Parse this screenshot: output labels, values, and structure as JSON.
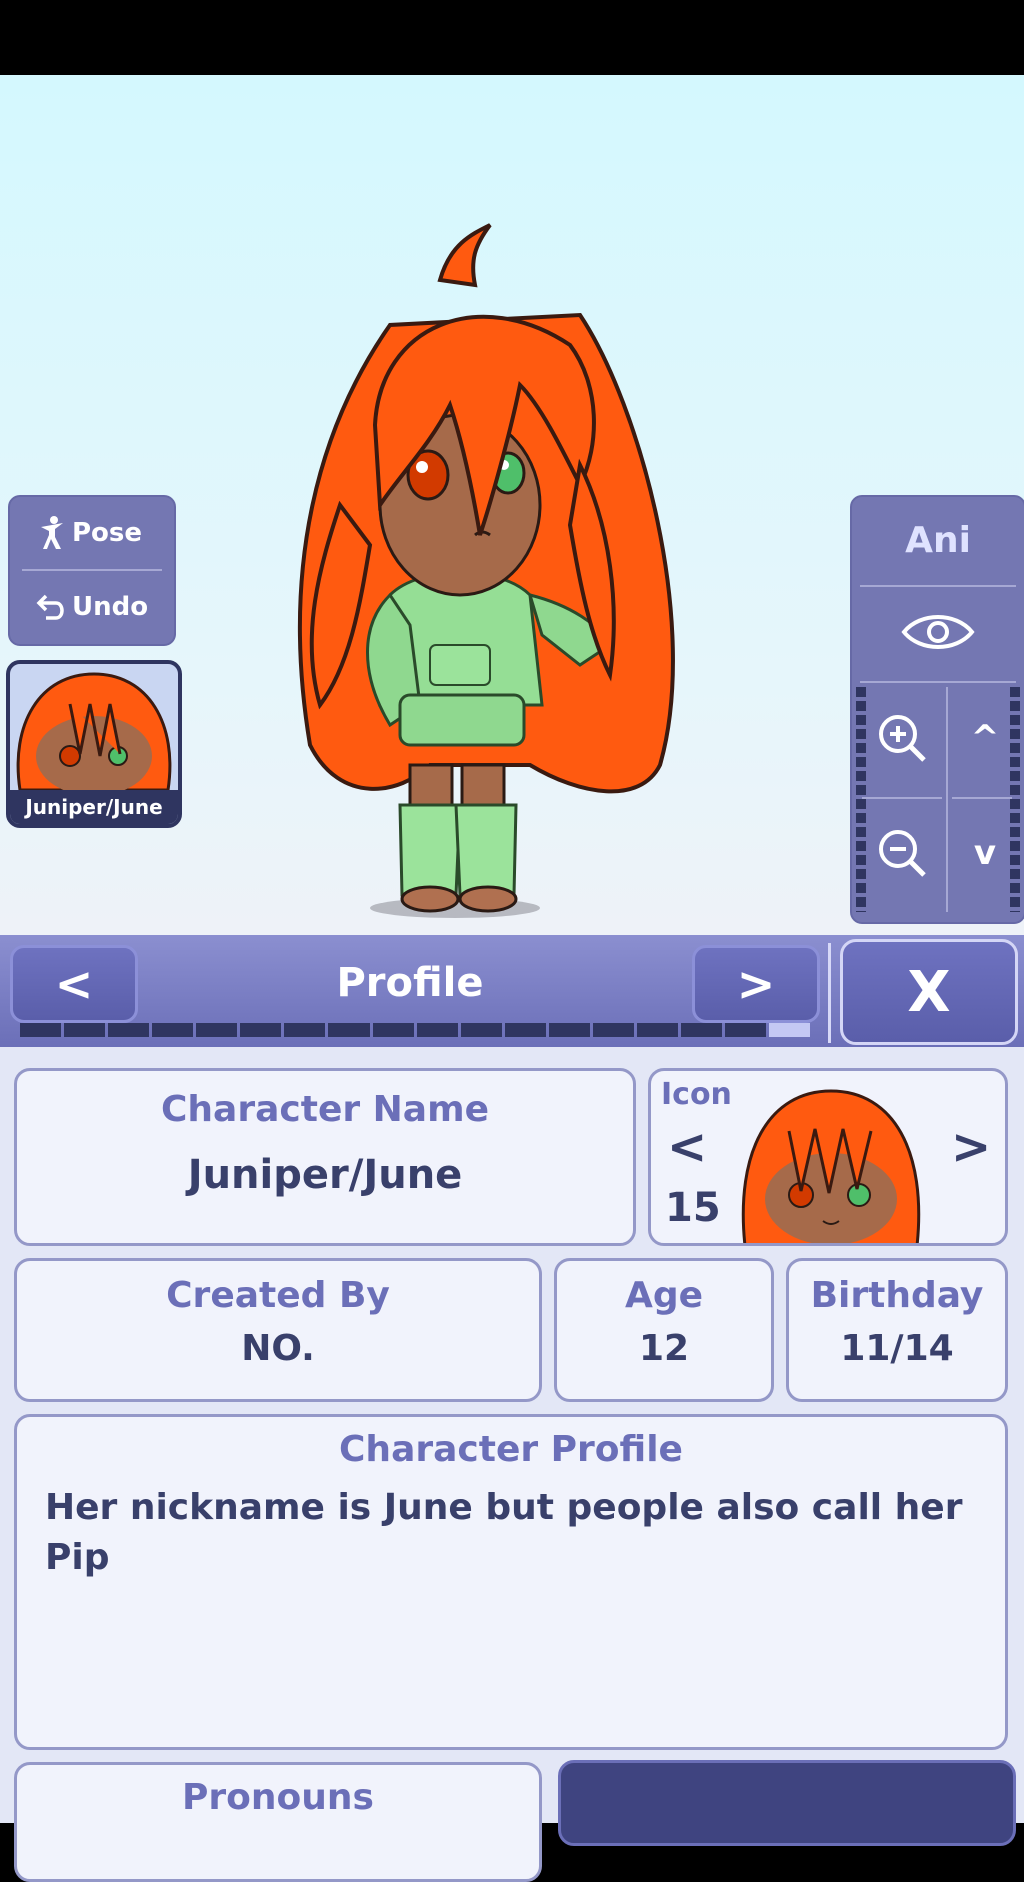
{
  "left_panel": {
    "pose_label": "Pose",
    "undo_label": "Undo"
  },
  "character_thumb": {
    "label": "Juniper/June"
  },
  "right_panel": {
    "ani_label": "Ani"
  },
  "header": {
    "title": "Profile",
    "prev": "<",
    "next": ">",
    "close": "X",
    "progress_segments": 18,
    "progress_active_index": 17
  },
  "profile": {
    "name_title": "Character Name",
    "name_value": "Juniper/June",
    "icon_label": "Icon",
    "icon_number": "15",
    "created_by_title": "Created By",
    "created_by_value": "NO.",
    "age_title": "Age",
    "age_value": "12",
    "birthday_title": "Birthday",
    "birthday_value": "11/14",
    "profile_title": "Character Profile",
    "profile_text": "Her nickname is June but people also call her Pip",
    "pronouns_title": "Pronouns"
  },
  "colors": {
    "panel": "#7477b2",
    "header": "#6b6fb8",
    "text_dark": "#39406b",
    "hair": "#ff5a10",
    "sweater": "#8fd88f"
  }
}
